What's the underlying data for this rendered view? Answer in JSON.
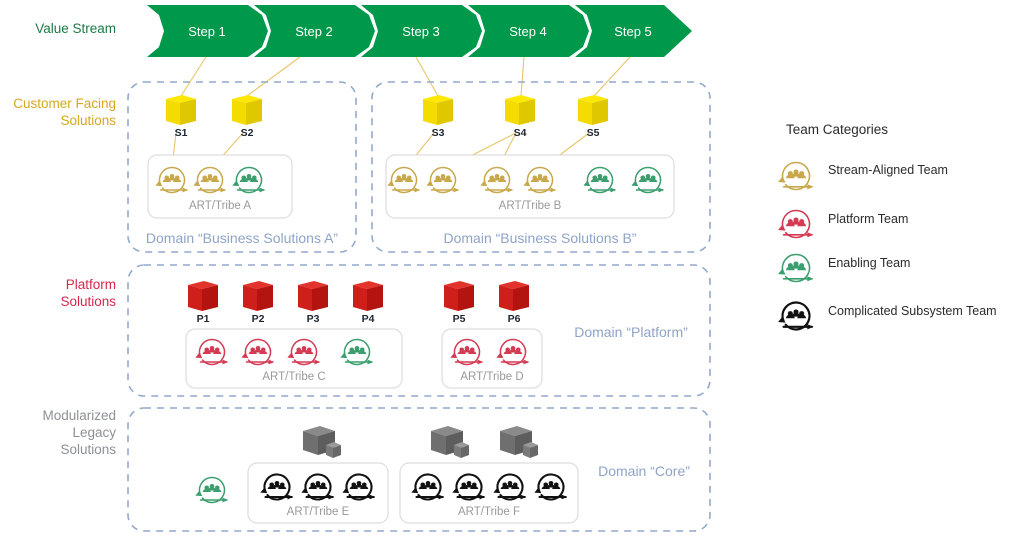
{
  "rows": {
    "value_stream": "Value Stream",
    "customer_facing": "Customer Facing\nSolutions",
    "platform": "Platform\nSolutions",
    "legacy": "Modularized\nLegacy\nSolutions"
  },
  "value_stream": {
    "steps": [
      "Step 1",
      "Step 2",
      "Step 3",
      "Step 4",
      "Step 5"
    ],
    "color": "#00984a"
  },
  "domains": [
    {
      "id": "business-solutions-a",
      "caption": "Domain “Business Solutions A”",
      "solutions": [
        {
          "label": "S1",
          "color": "#ffe500"
        },
        {
          "label": "S2",
          "color": "#ffe500"
        }
      ],
      "arts": [
        {
          "label": "ART/Tribe A",
          "teams": [
            "stream-aligned",
            "stream-aligned",
            "enabling"
          ]
        }
      ]
    },
    {
      "id": "business-solutions-b",
      "caption": "Domain “Business Solutions B”",
      "solutions": [
        {
          "label": "S3",
          "color": "#ffe500"
        },
        {
          "label": "S4",
          "color": "#ffe500"
        },
        {
          "label": "S5",
          "color": "#ffe500"
        }
      ],
      "arts": [
        {
          "label": "ART/Tribe B",
          "teams": [
            "stream-aligned",
            "stream-aligned",
            "stream-aligned",
            "stream-aligned",
            "enabling",
            "enabling"
          ]
        }
      ]
    },
    {
      "id": "platform",
      "caption": "Domain “Platform”",
      "solutions": [
        {
          "label": "P1",
          "color": "#d0021b"
        },
        {
          "label": "P2",
          "color": "#d0021b"
        },
        {
          "label": "P3",
          "color": "#d0021b"
        },
        {
          "label": "P4",
          "color": "#d0021b"
        },
        {
          "label": "P5",
          "color": "#d0021b"
        },
        {
          "label": "P6",
          "color": "#d0021b"
        }
      ],
      "arts": [
        {
          "label": "ART/Tribe C",
          "teams": [
            "platform",
            "platform",
            "platform",
            "enabling"
          ]
        },
        {
          "label": "ART/Tribe D",
          "teams": [
            "platform",
            "platform"
          ]
        }
      ]
    },
    {
      "id": "core",
      "caption": "Domain “Core”",
      "solutions": [
        {
          "label": "",
          "color": "#6e6e6e"
        },
        {
          "label": "",
          "color": "#6e6e6e"
        },
        {
          "label": "",
          "color": "#6e6e6e"
        }
      ],
      "standalone_teams": [
        "enabling"
      ],
      "arts": [
        {
          "label": "ART/Tribe E",
          "teams": [
            "complicated-subsystem",
            "complicated-subsystem",
            "complicated-subsystem"
          ]
        },
        {
          "label": "ART/Tribe F",
          "teams": [
            "complicated-subsystem",
            "complicated-subsystem",
            "complicated-subsystem",
            "complicated-subsystem"
          ]
        }
      ]
    }
  ],
  "legend": {
    "title": "Team Categories",
    "items": [
      {
        "icon": "stream-aligned-team-icon",
        "label": "Stream-Aligned Team",
        "color": "#c8a84b"
      },
      {
        "icon": "platform-team-icon",
        "label": "Platform Team",
        "color": "#d43b53"
      },
      {
        "icon": "enabling-team-icon",
        "label": "Enabling Team",
        "color": "#3b9e6e"
      },
      {
        "icon": "complicated-subsystem-team-icon",
        "label": "Complicated Subsystem Team",
        "color": "#111111"
      }
    ]
  },
  "colors": {
    "stream_aligned": "#c8a84b",
    "platform_team": "#d43b53",
    "enabling_team": "#3b9e6e",
    "complicated_subsystem": "#111111",
    "domain_border": "#93a9cd",
    "connector": "#e8c56a",
    "art_border": "#dddddd"
  }
}
